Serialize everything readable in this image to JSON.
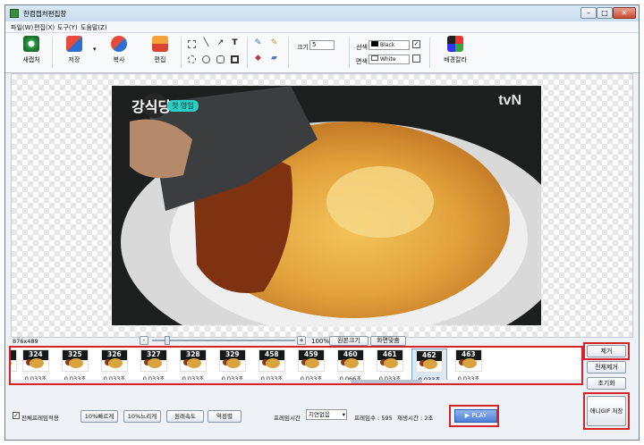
{
  "window": {
    "title": "한컴캡처편집창",
    "min": "–",
    "max": "□",
    "close": "✕"
  },
  "menu": [
    "파일(W)",
    "편집(X)",
    "도구(Y)",
    "도움말(Z)"
  ],
  "toolbar": {
    "new_capture": "새캡처",
    "save": "저장",
    "copy": "복사",
    "edit": "편집",
    "size_label": "크기",
    "size_value": "5",
    "line_label": "선색",
    "line_color": "Black",
    "fill_label": "면색",
    "fill_color": "White",
    "bg_label": "배경칼라"
  },
  "canvas": {
    "image_size": "876x489",
    "logo": "강식당",
    "caption": "첫 영업",
    "channel": "tvN"
  },
  "zoom": {
    "minus": "-",
    "plus": "+",
    "value": "100%",
    "original": "원본크기",
    "fit": "화면맞춤"
  },
  "frames": [
    {
      "num": "",
      "dur": "초"
    },
    {
      "num": "324",
      "dur": "0.033초"
    },
    {
      "num": "325",
      "dur": "0.033초"
    },
    {
      "num": "326",
      "dur": "0.033초"
    },
    {
      "num": "327",
      "dur": "0.033초"
    },
    {
      "num": "328",
      "dur": "0.033초"
    },
    {
      "num": "329",
      "dur": "0.033초"
    },
    {
      "num": "458",
      "dur": "0.033초"
    },
    {
      "num": "459",
      "dur": "0.033초"
    },
    {
      "num": "460",
      "dur": "0.066초"
    },
    {
      "num": "461",
      "dur": "0.033초"
    },
    {
      "num": "462",
      "dur": "0.033초"
    },
    {
      "num": "463",
      "dur": "0.033초"
    }
  ],
  "side": {
    "delete": "제거",
    "delete_all": "전체제거",
    "reset": "초기화",
    "save_gif": "애니GIF 저장"
  },
  "bottom": {
    "apply_all": "전체프레임적용",
    "faster": "10%빠르게",
    "slower": "10%느리게",
    "original_speed": "원래속도",
    "reverse": "역정렬",
    "frame_time_label": "프레임시간",
    "frame_time_value": "지연없음",
    "frame_count": "프레임수 : 595",
    "play_time": "재생시간 : 2초",
    "play": "▶ PLAY"
  }
}
